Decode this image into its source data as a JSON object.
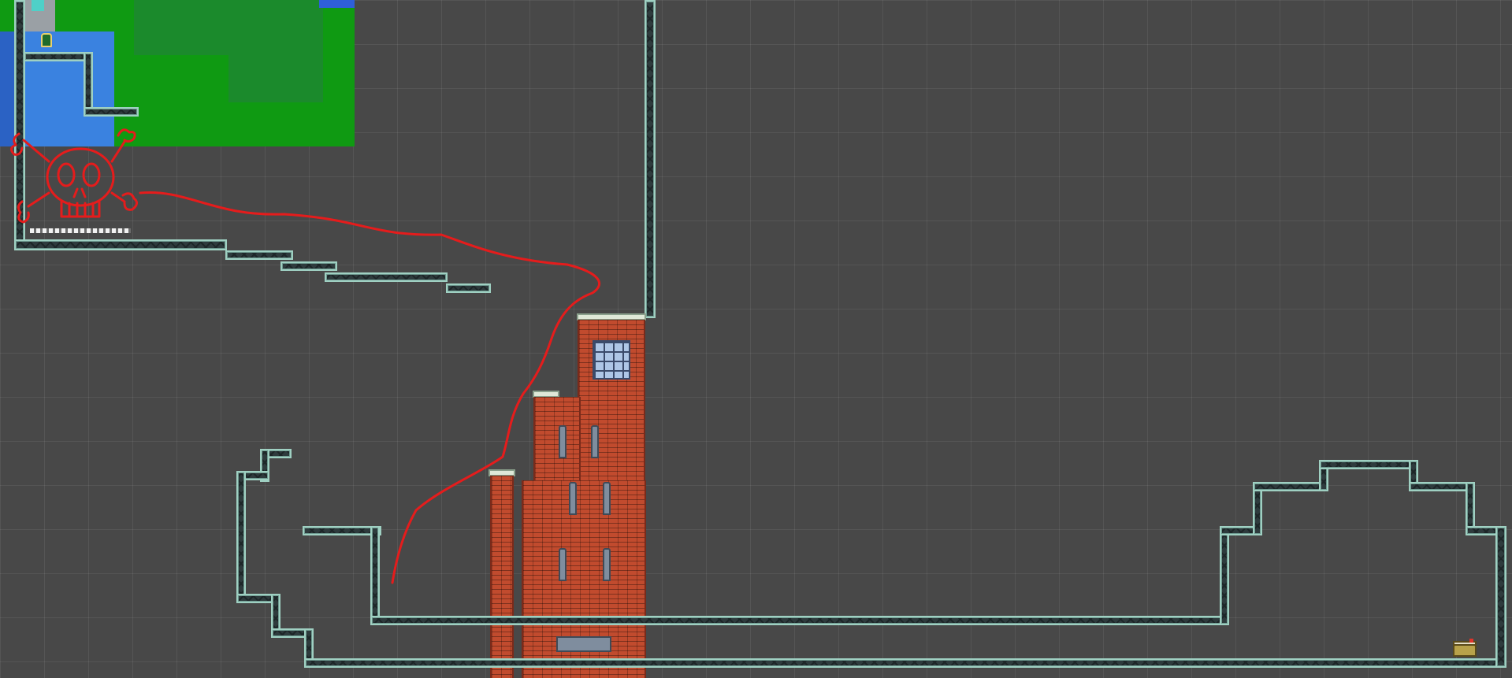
{
  "scene": {
    "view": "level-editor-scene",
    "background_color": "#484848",
    "grid_color": "rgba(255,255,255,0.07)"
  },
  "colors": {
    "girder_frame": "#9fd0c2",
    "girder_fill": "#2e3b3d",
    "brick": "#c14b2e",
    "annotation_red": "#e51c1c",
    "water": "#3a82e0",
    "grass": "#0f9a12"
  },
  "minimap": {
    "icon": "world-minimap",
    "contents": [
      "water-area",
      "grass-area",
      "player-sprite"
    ]
  },
  "annotations": {
    "skull": "skull-and-crossbones-icon",
    "path": "red-hand-drawn-path"
  },
  "objects": {
    "player": "player-sprite-icon",
    "spikes": "spike-row",
    "tower": "brick-tower",
    "window": "grid-window-icon",
    "chest": "treasure-chest-icon"
  }
}
